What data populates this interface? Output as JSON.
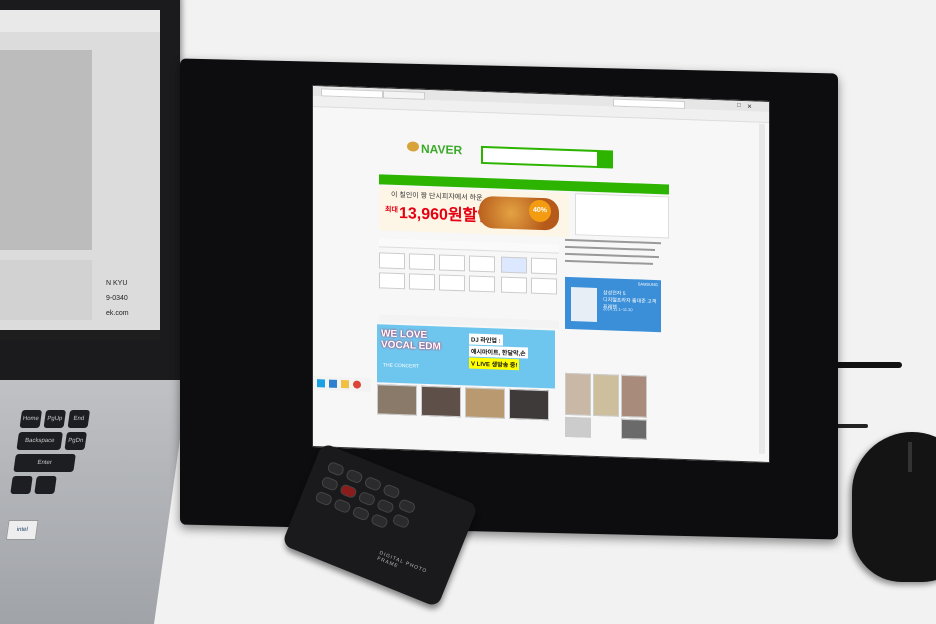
{
  "scene": {
    "description_colors": {
      "background": "#f2f2f2",
      "naver_green": "#2db400",
      "edm_blue": "#6ec6ee",
      "samsung_blue": "#3b8fd8"
    }
  },
  "laptop": {
    "screen_fragments": [
      "N KYU",
      "9-0340",
      "ek.com"
    ],
    "keys": [
      "Enter",
      "PgUp",
      "PgDn",
      "Home",
      "Backspace",
      "End"
    ],
    "sticker": "intel"
  },
  "browser": {
    "logo": "NAVER",
    "ad": {
      "headline": "이 칠인이 짱 단시피자에서 하운",
      "prefix": "최대",
      "price": "13,960원할인!",
      "badge": "40%"
    },
    "samsung_ad": {
      "brand": "SAMSUNG",
      "headline_line1": "삼성전자 5",
      "headline_line2": "디지털프라자 출대준 고객 프레젠",
      "sub": "2014.11.1~11.30"
    },
    "edm_banner": {
      "title_line1": "WE LOVE",
      "title_line2": "VOCAL EDM",
      "sub": "THE CONCERT",
      "dj_line1": "DJ 라인업 :",
      "dj_line2": "애시마이트, 한달막,손",
      "dj_line3": "V LIVE 생방송 중!"
    }
  },
  "remote": {
    "label": "DIGITAL PHOTO FRAME"
  }
}
